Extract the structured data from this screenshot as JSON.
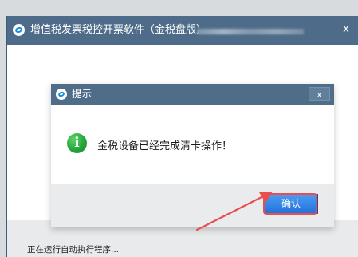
{
  "window": {
    "title": "增值税发票税控开票软件（金税盘版）",
    "close_symbol": "x"
  },
  "dialog": {
    "title": "提示",
    "close_symbol": "x",
    "message": "金税设备已经完成清卡操作！",
    "confirm_label": "确认",
    "info_symbol": "i"
  },
  "status": {
    "text": "正在运行自动执行程序..."
  },
  "colors": {
    "titlebar": "#4e6c89",
    "confirm_button": "#2f84ea",
    "annotation": "#ea4d4d",
    "info_icon": "#24a63b"
  },
  "icons": {
    "app": "app-logo-icon",
    "dialog": "dialog-logo-icon",
    "info": "info-icon",
    "close": "close-icon",
    "arrow": "annotation-arrow-icon"
  }
}
